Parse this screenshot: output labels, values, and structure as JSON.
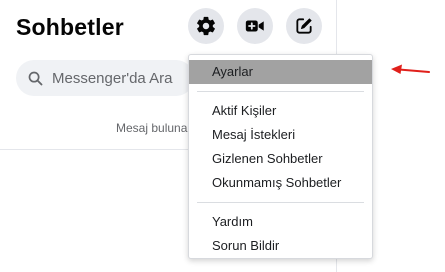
{
  "header": {
    "title": "Sohbetler"
  },
  "toolbar": {
    "settings_icon": "gear-icon",
    "video_icon": "video-camera-plus-icon",
    "compose_icon": "compose-edit-icon"
  },
  "search": {
    "placeholder": "Messenger'da Ara",
    "value": ""
  },
  "empty_state": {
    "text": "Mesaj buluna"
  },
  "menu": {
    "items_top": [
      "Ayarlar"
    ],
    "items_middle": [
      "Aktif Kişiler",
      "Mesaj İstekleri",
      "Gizlenen Sohbetler",
      "Okunmamış Sohbetler"
    ],
    "items_bottom": [
      "Yardım",
      "Sorun Bildir"
    ]
  },
  "colors": {
    "menu_highlight": "#a2a2a2",
    "button_bg": "#e4e6eb",
    "annotation_arrow": "#e0201b"
  }
}
